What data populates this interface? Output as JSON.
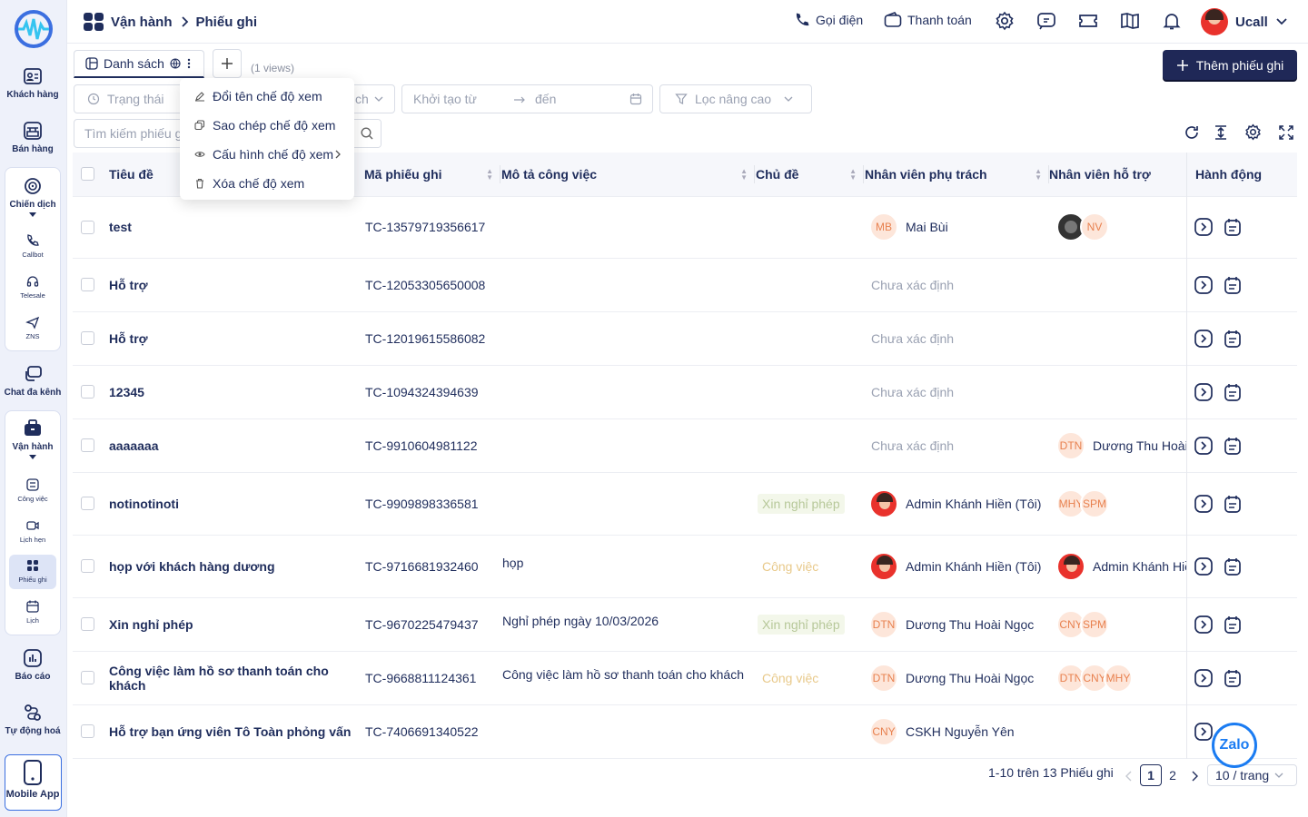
{
  "sidebar": {
    "items": [
      {
        "label": "Khách hàng"
      },
      {
        "label": "Bán hàng"
      },
      {
        "label": "Chiến dịch"
      },
      {
        "label": "Callbot"
      },
      {
        "label": "Telesale"
      },
      {
        "label": "ZNS"
      },
      {
        "label": "Chat đa kênh"
      },
      {
        "label": "Vận hành"
      },
      {
        "label": "Công việc"
      },
      {
        "label": "Lịch hẹn"
      },
      {
        "label": "Phiếu ghi"
      },
      {
        "label": "Lịch"
      },
      {
        "label": "Báo cáo"
      },
      {
        "label": "Tự động hoá"
      },
      {
        "label": "Mobile App"
      }
    ]
  },
  "header": {
    "breadcrumb_root": "Vận hành",
    "breadcrumb_current": "Phiếu ghi",
    "call_label": "Gọi điện",
    "payment_label": "Thanh toán",
    "user_name": "Ucall"
  },
  "views": {
    "tab_label": "Danh sách",
    "count_label": "(1 views)",
    "add_button_label": "Thêm phiếu ghi"
  },
  "context_menu": {
    "rename": "Đổi tên chế độ xem",
    "copy": "Sao chép chế độ xem",
    "configure": "Cấu hình chế độ xem",
    "delete": "Xóa chế độ xem"
  },
  "filters": {
    "status_placeholder": "Trạng thái",
    "hidden_chip_fragment": "ch",
    "created_from_placeholder": "Khởi tạo từ",
    "created_to_placeholder": "đến",
    "advanced_filter_label": "Lọc nâng cao",
    "search_placeholder": "Tìm kiếm phiếu ghi"
  },
  "table": {
    "columns": [
      "Tiêu đề",
      "Mã phiếu ghi",
      "Mô tả công việc",
      "Chủ đề",
      "Nhân viên phụ trách",
      "Nhân viên hỗ trợ",
      "Hành động"
    ],
    "rows": [
      {
        "title": "test",
        "code": "TC-13579719356617",
        "desc": "",
        "topic": "",
        "owner_avatar": "MB",
        "owner": "Mai Bùi",
        "support": [
          "",
          "NV"
        ],
        "support_name": ""
      },
      {
        "title": "Hỗ trợ",
        "code": "TC-12053305650008",
        "desc": "",
        "topic": "",
        "owner_avatar": "",
        "owner": "Chưa xác định",
        "support": [],
        "support_name": ""
      },
      {
        "title": "Hỗ trợ",
        "code": "TC-12019615586082",
        "desc": "",
        "topic": "",
        "owner_avatar": "",
        "owner": "Chưa xác định",
        "support": [],
        "support_name": ""
      },
      {
        "title": "12345",
        "code": "TC-1094324394639",
        "desc": "",
        "topic": "",
        "owner_avatar": "",
        "owner": "Chưa xác định",
        "support": [],
        "support_name": ""
      },
      {
        "title": "aaaaaaa",
        "code": "TC-9910604981122",
        "desc": "",
        "topic": "",
        "owner_avatar": "",
        "owner": "Chưa xác định",
        "support": [
          "DTN"
        ],
        "support_name": "Dương Thu Hoài N"
      },
      {
        "title": "notinotinoti",
        "code": "TC-9909898336581",
        "desc": "",
        "topic": "Xin nghỉ phép",
        "owner_avatar": "photo",
        "owner": "Admin Khánh Hiền (Tôi)",
        "support": [
          "MHY",
          "SPM"
        ],
        "support_name": ""
      },
      {
        "title": "họp với khách hàng dương",
        "code": "TC-9716681932460",
        "desc": "họp",
        "topic": "Công việc",
        "owner_avatar": "photo",
        "owner": "Admin Khánh Hiền (Tôi)",
        "support": [
          "photo"
        ],
        "support_name": "Admin Khánh Hiền"
      },
      {
        "title": "Xin nghỉ phép",
        "code": "TC-9670225479437",
        "desc": "Nghỉ phép ngày 10/03/2026",
        "topic": "Xin nghỉ phép",
        "owner_avatar": "DTN",
        "owner": "Dương Thu Hoài Ngọc",
        "support": [
          "CNY",
          "SPM"
        ],
        "support_name": ""
      },
      {
        "title": "Công việc làm hồ sơ thanh toán cho khách",
        "code": "TC-9668811124361",
        "desc": "Công việc làm hồ sơ thanh toán cho khách",
        "topic": "Công việc",
        "owner_avatar": "DTN",
        "owner": "Dương Thu Hoài Ngọc",
        "support": [
          "DTN",
          "CNY",
          "MHY"
        ],
        "support_name": ""
      },
      {
        "title": "Hỗ trợ bạn ứng viên Tô Toàn phỏng vấn",
        "code": "TC-7406691340522",
        "desc": "",
        "topic": "",
        "owner_avatar": "CNY",
        "owner": "CSKH Nguyễn Yên",
        "support": [],
        "support_name": ""
      }
    ]
  },
  "pagination": {
    "summary": "1-10 trên 13 Phiếu ghi",
    "pages": [
      "1",
      "2"
    ],
    "page_size": "10 / trang"
  },
  "zalo_label": "Zalo",
  "colors": {
    "primary": "#1f2857",
    "sidebar_bg": "#eef1fa",
    "avatar_bg": "#fde6da",
    "avatar_text": "#e8814f"
  }
}
